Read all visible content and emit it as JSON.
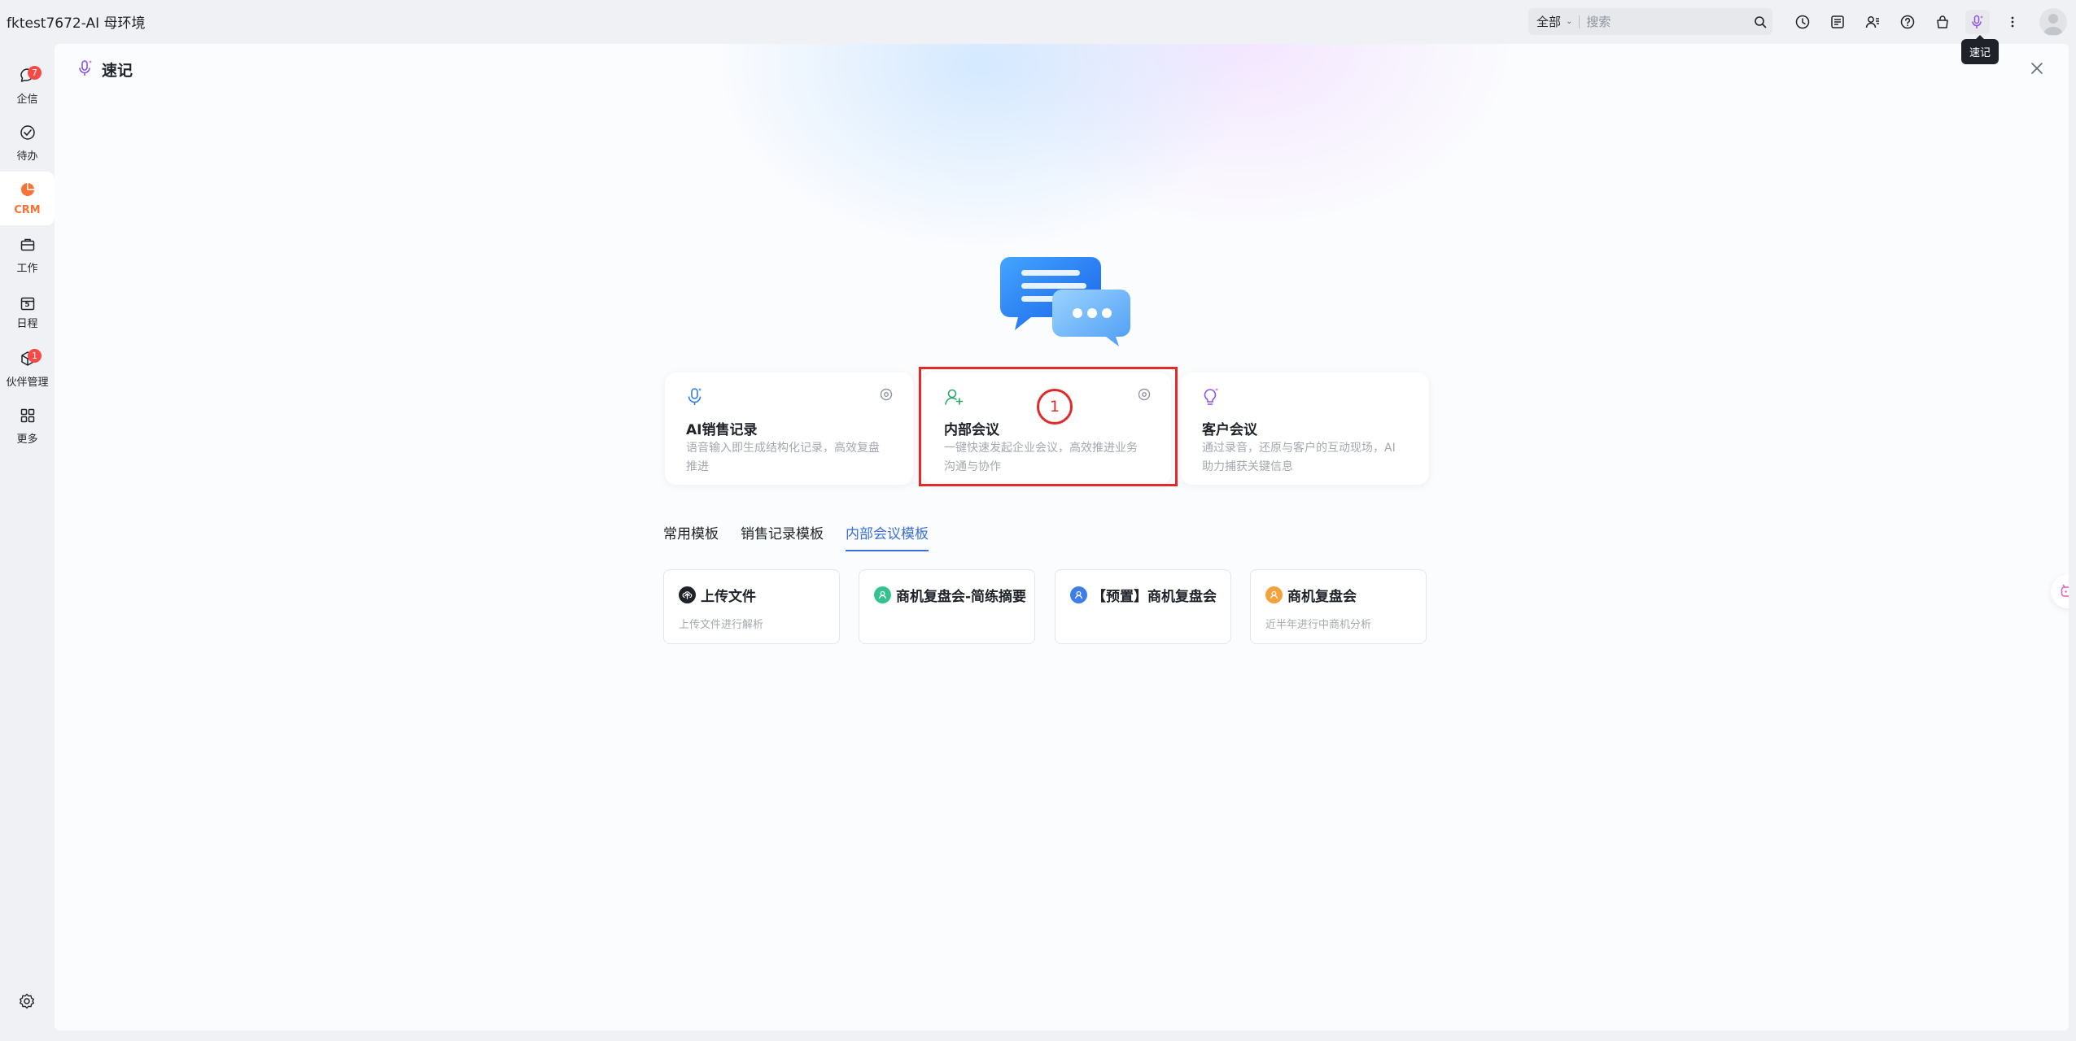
{
  "app": {
    "title": "fktest7672-AI 母环境"
  },
  "search": {
    "scope": "全部",
    "placeholder": "搜索"
  },
  "top_icons": [
    "history-icon",
    "notes-icon",
    "contacts-icon",
    "help-icon",
    "shop-icon",
    "voice-note-icon",
    "more-icon"
  ],
  "tooltip": "速记",
  "sidebar": {
    "items": [
      {
        "label": "企信",
        "icon": "chat-icon",
        "badge": "7"
      },
      {
        "label": "待办",
        "icon": "todo-icon",
        "badge": ""
      },
      {
        "label": "CRM",
        "icon": "crm-icon",
        "badge": ""
      },
      {
        "label": "工作",
        "icon": "briefcase-icon",
        "badge": ""
      },
      {
        "label": "日程",
        "icon": "calendar-icon",
        "badge": "",
        "calendar_day": "5"
      },
      {
        "label": "伙伴管理",
        "icon": "partner-icon",
        "badge": "1"
      },
      {
        "label": "更多",
        "icon": "grid-icon",
        "badge": ""
      }
    ]
  },
  "panel": {
    "title": "速记"
  },
  "modes": [
    {
      "title": "AI销售记录",
      "desc": "语音输入即生成结构化记录，高效复盘推进"
    },
    {
      "title": "内部会议",
      "desc": "一键快速发起企业会议，高效推进业务沟通与协作"
    },
    {
      "title": "客户会议",
      "desc": "通过录音，还原与客户的互动现场，AI助力捕获关键信息"
    }
  ],
  "step_marker": "1",
  "tabs": [
    {
      "label": "常用模板",
      "active": false
    },
    {
      "label": "销售记录模板",
      "active": false
    },
    {
      "label": "内部会议模板",
      "active": true
    }
  ],
  "templates": [
    {
      "title": "上传文件",
      "desc": "上传文件进行解析",
      "color": "#1f2329"
    },
    {
      "title": "商机复盘会-简练摘要",
      "desc": "",
      "color": "#34c38f"
    },
    {
      "title": "【预置】商机复盘会",
      "desc": "",
      "color": "#3e7ee8"
    },
    {
      "title": "商机复盘会",
      "desc": "近半年进行中商机分析",
      "color": "#f5a23d"
    }
  ],
  "colors": {
    "accent": "#3b6fd6",
    "crm_active": "#f77234",
    "highlight": "#e12a2a"
  }
}
